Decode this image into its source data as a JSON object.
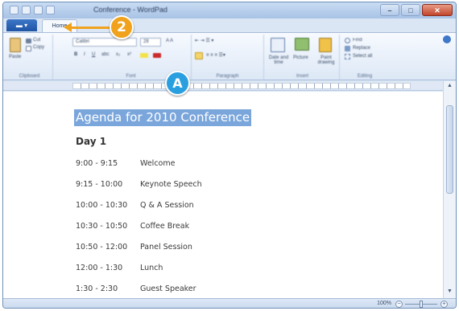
{
  "window": {
    "title": "Conference - WordPad"
  },
  "tabs": {
    "file": "",
    "home": "Home"
  },
  "ribbon": {
    "clipboard": {
      "paste": "Paste",
      "cut": "Cut",
      "copy": "Copy",
      "label": "Clipboard"
    },
    "font": {
      "font_name": "Calibri",
      "font_size": "28",
      "label": "Font"
    },
    "paragraph": {
      "label": "Paragraph"
    },
    "insert": {
      "date_time": "Date and time",
      "picture": "Picture",
      "paint_drawing": "Paint drawing",
      "label": "Insert"
    },
    "editing": {
      "find": "Find",
      "replace": "Replace",
      "select_all": "Select all",
      "label": "Editing"
    }
  },
  "document": {
    "title": "Agenda for 2010 Conference",
    "day": "Day 1",
    "agenda": [
      {
        "time": "9:00 - 9:15",
        "event": "Welcome"
      },
      {
        "time": "9:15 - 10:00",
        "event": "Keynote Speech"
      },
      {
        "time": "10:00 - 10:30",
        "event": "Q & A Session"
      },
      {
        "time": "10:30 - 10:50",
        "event": "Coffee Break"
      },
      {
        "time": "10:50 - 12:00",
        "event": "Panel Session"
      },
      {
        "time": "12:00 - 1:30",
        "event": "Lunch"
      },
      {
        "time": "1:30 - 2:30",
        "event": "Guest Speaker"
      }
    ]
  },
  "statusbar": {
    "zoom": "100%"
  },
  "callouts": {
    "step": "2",
    "marker": "A"
  },
  "colors": {
    "callout_step": "#f0a21c",
    "callout_marker": "#2a9fe0",
    "selection": "#7aa6dc"
  }
}
